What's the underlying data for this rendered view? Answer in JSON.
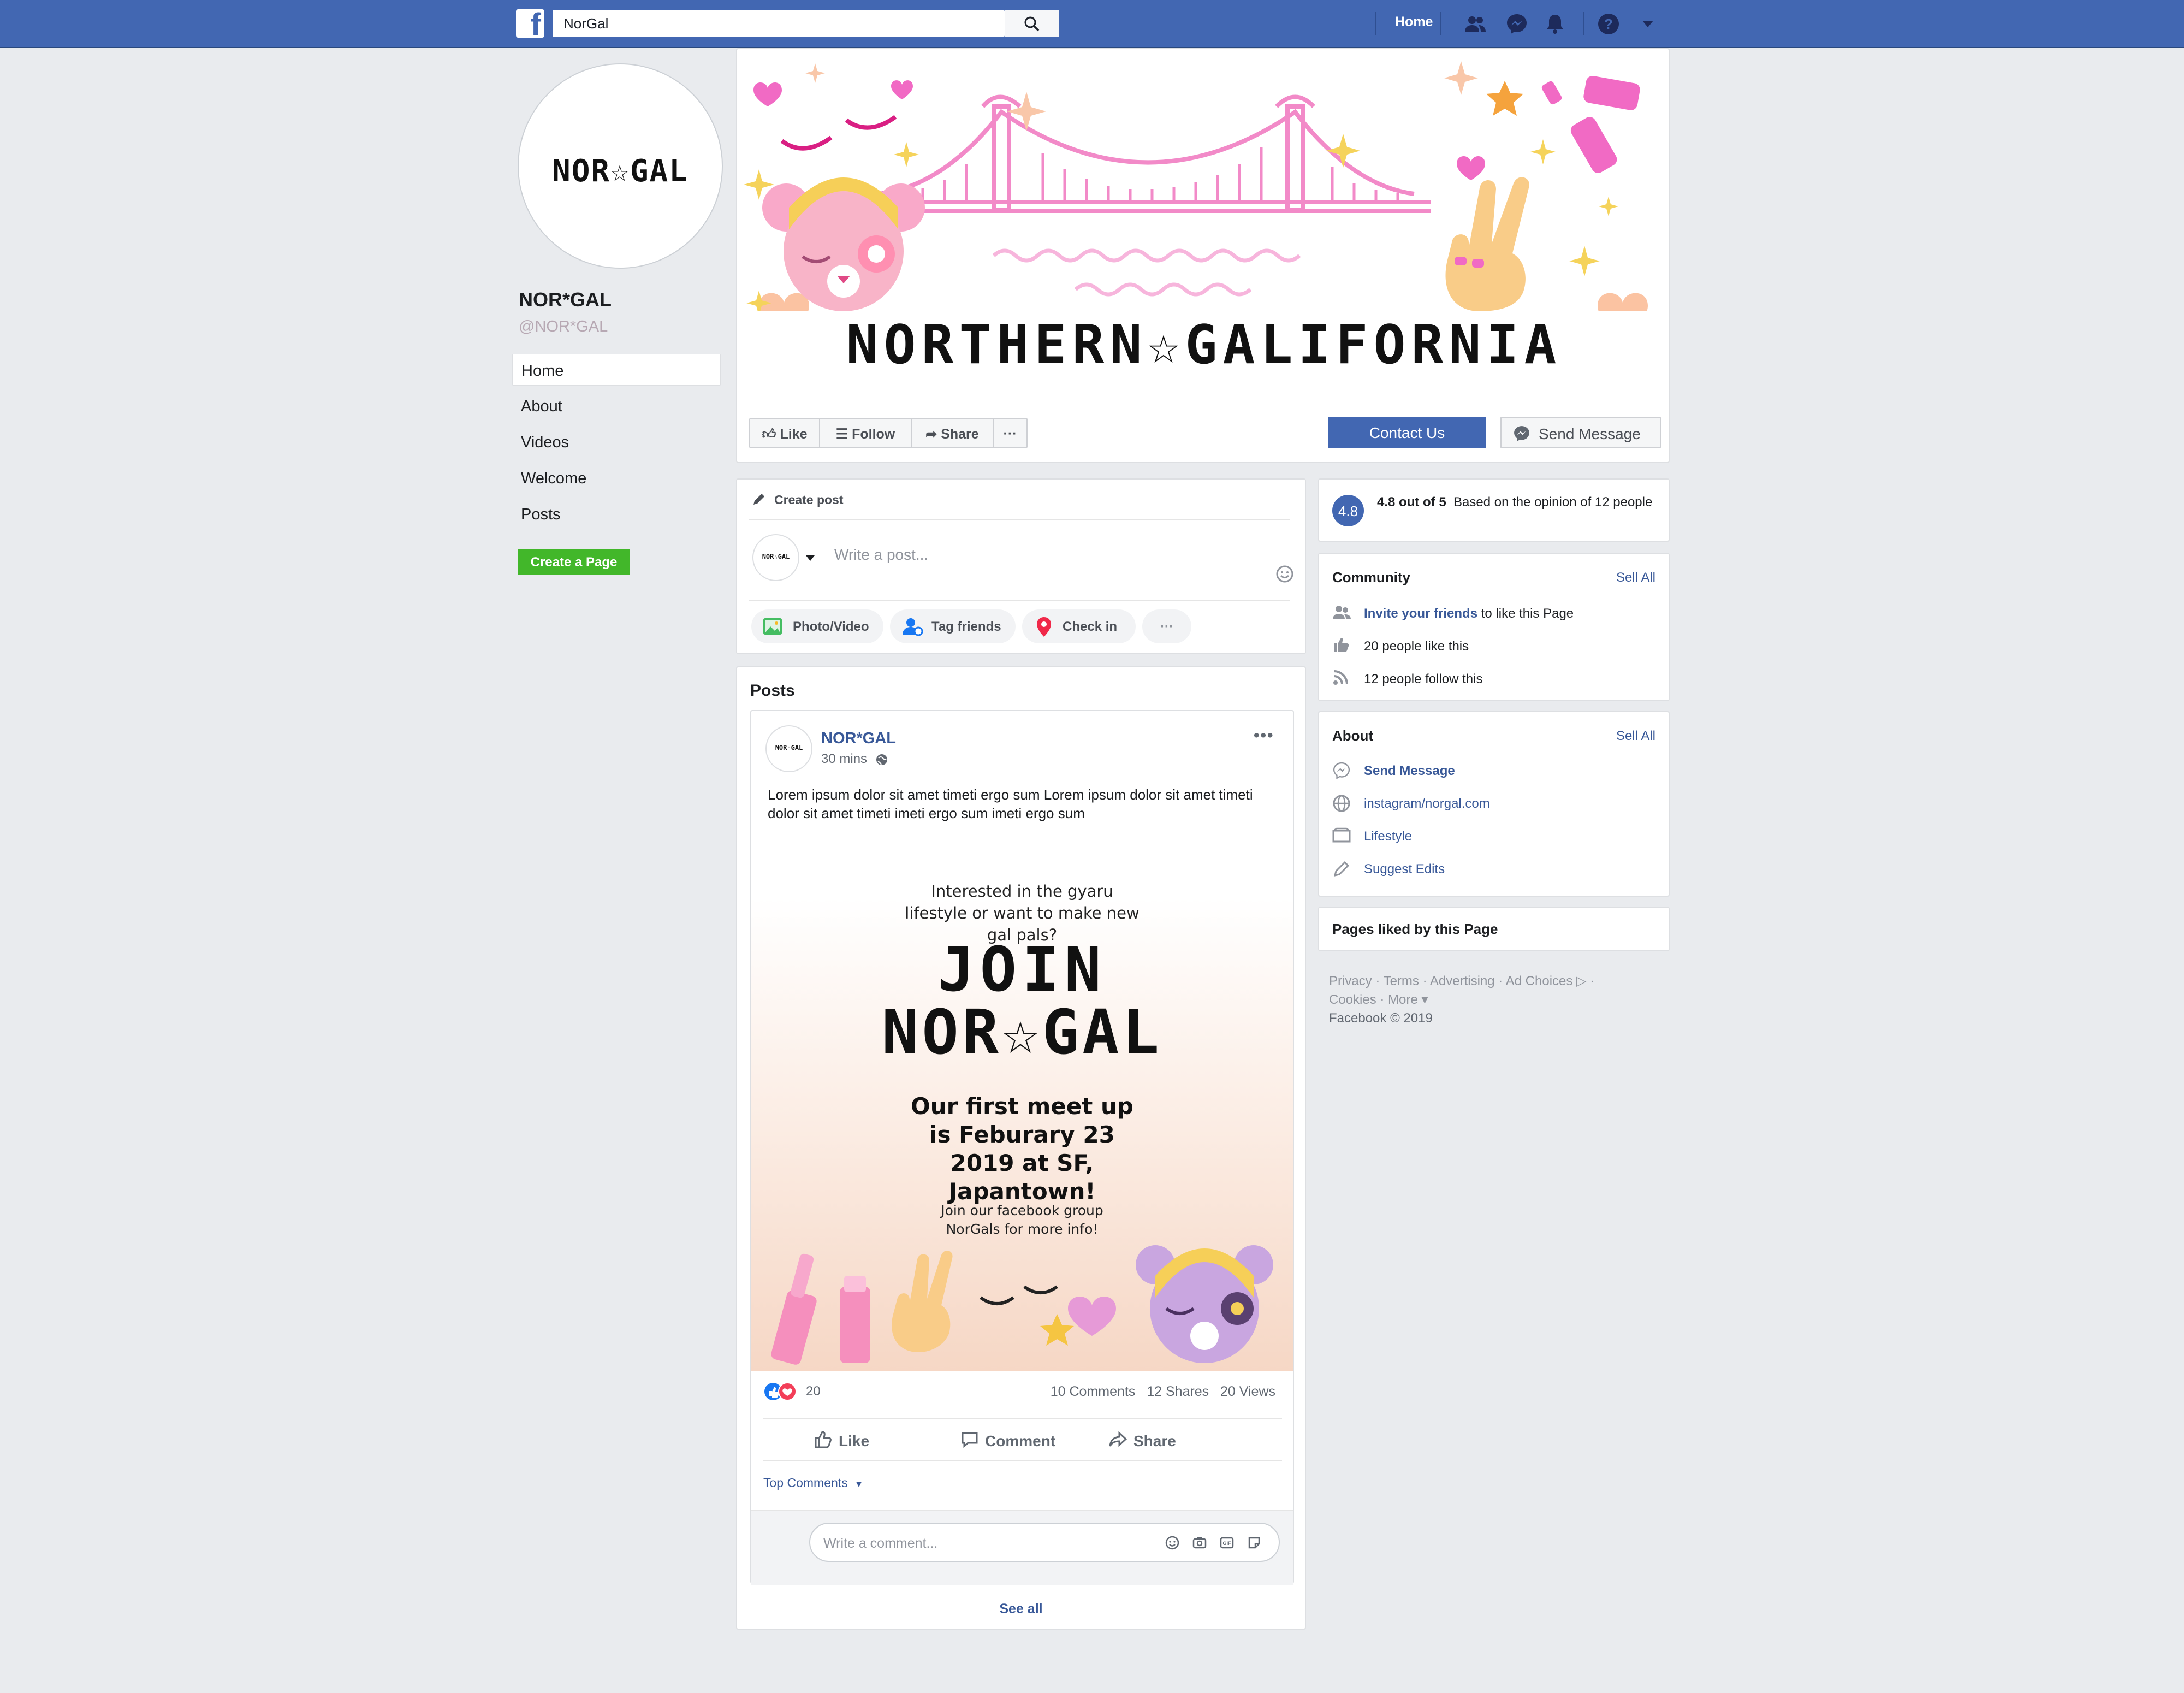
{
  "topbar": {
    "logo": "f",
    "search_value": "NorGal",
    "home_label": "Home",
    "icons": [
      "friends-icon",
      "messenger-icon",
      "notifications-icon",
      "help-icon",
      "dropdown-icon"
    ]
  },
  "profile": {
    "logo_text": "NOR☆GAL",
    "name": "NOR*GAL",
    "handle": "@NOR*GAL"
  },
  "left_nav": {
    "items": [
      "Home",
      "About",
      "Videos",
      "Welcome",
      "Posts"
    ],
    "create_page": "Create a Page"
  },
  "cover": {
    "title": "NORTHERN☆GALIFORNIA",
    "actions": {
      "like": "Like",
      "follow": "Follow",
      "share": "Share",
      "more": "···"
    },
    "contact": "Contact Us",
    "send_message": "Send Message"
  },
  "create_post": {
    "header": "Create post",
    "placeholder": "Write a post...",
    "avatar_text": "NOR☆GAL",
    "pills": [
      "Photo/Video",
      "Tag friends",
      "Check in",
      "···"
    ]
  },
  "feed": {
    "heading": "Posts",
    "post": {
      "author": "NOR*GAL",
      "time": "30 mins",
      "avatar_text": "NOR☆GAL",
      "text": "Lorem ipsum dolor sit amet timeti ergo sum Lorem ipsum dolor sit amet timeti dolor sit amet timeti imeti ergo sum imeti ergo sum",
      "flyer": {
        "question": "Interested in the gyaru lifestyle or want to make new gal pals?",
        "join": "JOIN",
        "brand": "NOR☆GAL",
        "meetup": "Our first meet up is Feburary 23 2019 at SF, Japantown!",
        "info": "Join our facebook group NorGals for more info!"
      },
      "reaction_count": "20",
      "stats": {
        "comments": "10 Comments",
        "shares": "12 Shares",
        "views": "20 Views"
      },
      "actions": {
        "like": "Like",
        "comment": "Comment",
        "share": "Share"
      },
      "top_comments": "Top Comments",
      "comment_placeholder": "Write a comment..."
    },
    "see_all": "See all"
  },
  "rating": {
    "score": "4.8",
    "summary_bold": "4.8 out of 5",
    "summary_rest": "Based  on the opinion of 12 people"
  },
  "community": {
    "title": "Community",
    "see_all": "Sell All",
    "invite_link": "Invite your friends",
    "invite_rest": "to like this Page",
    "likes": "20 people like this",
    "follows": "12 people follow this"
  },
  "about": {
    "title": "About",
    "see_all": "Sell All",
    "send_message": "Send Message",
    "website": "instagram/norgal.com",
    "category": "Lifestyle",
    "suggest": "Suggest Edits"
  },
  "pages_liked": {
    "title": "Pages liked by this Page"
  },
  "footer": {
    "line1": "Privacy · Terms · Advertising · Ad Choices ▷ ·",
    "line2": "Cookies · More ▾",
    "copyright": "Facebook © 2019"
  },
  "colors": {
    "brand_blue": "#4267b2",
    "link_blue": "#385898",
    "create_green": "#42b72a",
    "accent_pink": "#e84aa8",
    "star_yellow": "#f5c542"
  }
}
